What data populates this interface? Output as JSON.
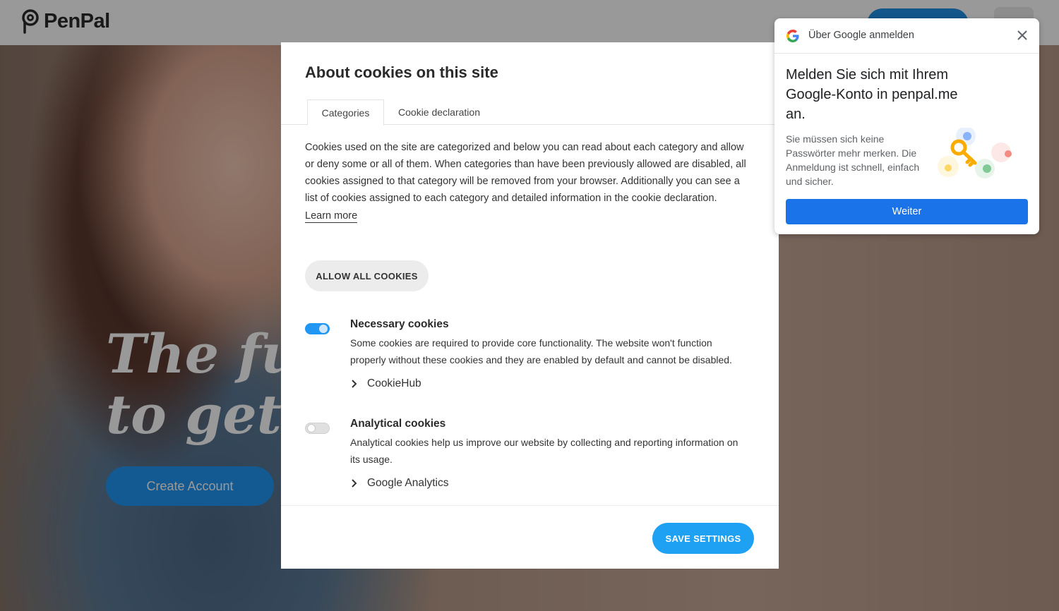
{
  "site": {
    "brand": "PenPal",
    "hero_title_line1": "The fu",
    "hero_title_line2": "to get a",
    "create_account_label": "Create Account"
  },
  "cookie_dialog": {
    "title": "About cookies on this site",
    "tabs": [
      {
        "label": "Categories",
        "active": true
      },
      {
        "label": "Cookie declaration",
        "active": false
      }
    ],
    "description": "Cookies used on the site are categorized and below you can read about each category and allow or deny some or all of them. When categories than have been previously allowed are disabled, all cookies assigned to that category will be removed from your browser. Additionally you can see a list of cookies assigned to each category and detailed information in the cookie declaration.",
    "learn_more_label": "Learn more",
    "allow_all_label": "ALLOW ALL COOKIES",
    "categories": [
      {
        "title": "Necessary cookies",
        "description": "Some cookies are required to provide core functionality. The website won't function properly without these cookies and they are enabled by default and cannot be disabled.",
        "enabled": true,
        "vendor": "CookieHub"
      },
      {
        "title": "Analytical cookies",
        "description": "Analytical cookies help us improve our website by collecting and reporting information on its usage.",
        "enabled": false,
        "vendor": "Google Analytics"
      }
    ],
    "save_label": "SAVE SETTINGS"
  },
  "google_signin": {
    "header": "Über Google anmelden",
    "title": "Melden Sie sich mit Ihrem Google-Konto in penpal.me an.",
    "text": "Sie müssen sich keine Passwörter mehr merken. Die Anmeldung ist schnell, einfach und sicher.",
    "button_label": "Weiter"
  },
  "colors": {
    "accent": "#2196f3",
    "google_blue": "#1a73e8",
    "toggle_on": "#2196f3"
  }
}
